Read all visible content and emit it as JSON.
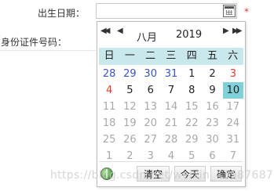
{
  "form": {
    "birth_date_label": "出生日期：",
    "id_number_label": "身份证件号码：",
    "required_mark": "*",
    "calendar_button_icon": "calendar-icon"
  },
  "datepicker": {
    "nav": {
      "prev_year": "◀◀",
      "prev_month": "◀",
      "next_month": "▶",
      "next_year": "▶▶"
    },
    "month": "八月",
    "year": "2019",
    "weekdays": [
      "日",
      "一",
      "二",
      "三",
      "四",
      "五",
      "六"
    ],
    "days": [
      [
        "28",
        "29",
        "30",
        "31",
        "1",
        "2",
        "3"
      ],
      [
        "4",
        "5",
        "6",
        "7",
        "8",
        "9",
        "10"
      ],
      [
        "11",
        "12",
        "13",
        "14",
        "15",
        "16",
        "17"
      ],
      [
        "18",
        "19",
        "20",
        "21",
        "22",
        "23",
        "24"
      ],
      [
        "25",
        "26",
        "27",
        "28",
        "29",
        "30",
        "31"
      ],
      [
        "1",
        "2",
        "3",
        "4",
        "5",
        "6",
        "7"
      ]
    ],
    "selected_day": "10",
    "footer": {
      "clear_label": "清空",
      "today_label": "今天",
      "ok_label": "确定",
      "globe_icon": "globe-icon"
    },
    "colors": {
      "weekday_header_bg": "#c9e8ec",
      "selected_bg": "#7fd0d8",
      "weekend_red": "#e33b2f",
      "prev_month_blue": "#3b55c4",
      "disabled_gray": "#a8a8a8"
    }
  },
  "watermark": "https://blog.csdn.net/weixin_43987687"
}
